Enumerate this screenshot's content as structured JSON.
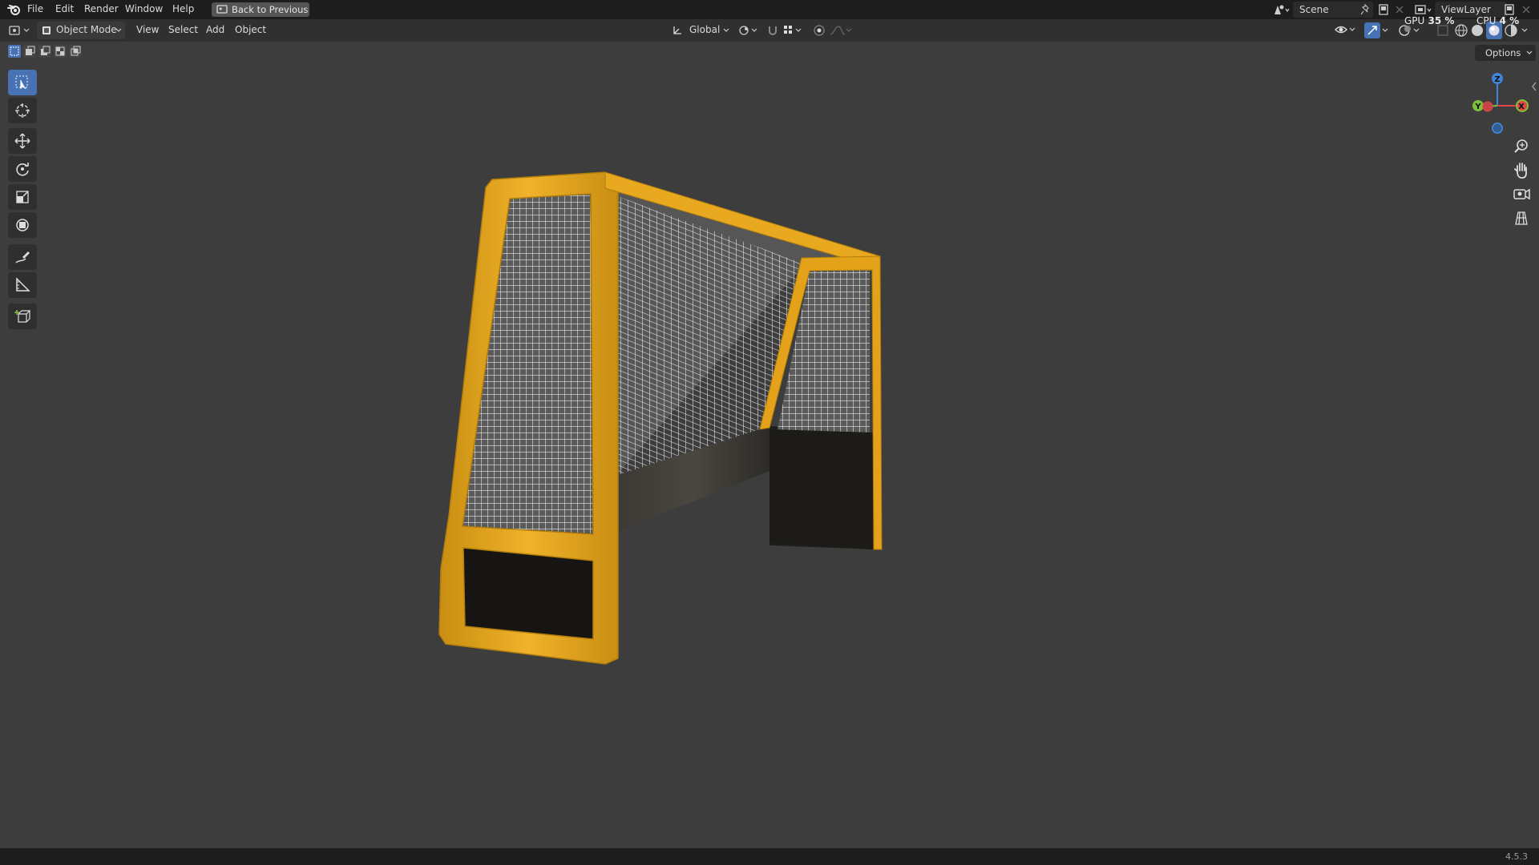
{
  "menu": {
    "file": "File",
    "edit": "Edit",
    "render": "Render",
    "window": "Window",
    "help": "Help",
    "back_button": "Back to Previous"
  },
  "scene": {
    "label": "Scene"
  },
  "view_layer": {
    "label": "ViewLayer"
  },
  "header": {
    "mode": "Object Mode",
    "view": "View",
    "select": "Select",
    "add": "Add",
    "object": "Object",
    "transform_orientation": "Global",
    "options": "Options"
  },
  "stats": {
    "gpu_label": "GPU",
    "gpu_value": "35 %",
    "cpu_label": "CPU",
    "cpu_value": "4 %"
  },
  "gizmo": {
    "z": "Z",
    "y": "Y",
    "x": "X"
  },
  "status": {
    "version": "4.5.3"
  },
  "colors": {
    "accent": "#4772b3",
    "frame": "#e3a21a",
    "axis_x": "#e04848",
    "axis_y": "#7fbf3a",
    "axis_z": "#3f86d8"
  },
  "tools": [
    "select-box-icon",
    "cursor-icon",
    "move-icon",
    "rotate-icon",
    "scale-icon",
    "transform-icon",
    "annotate-icon",
    "measure-icon",
    "add-cube-icon"
  ]
}
